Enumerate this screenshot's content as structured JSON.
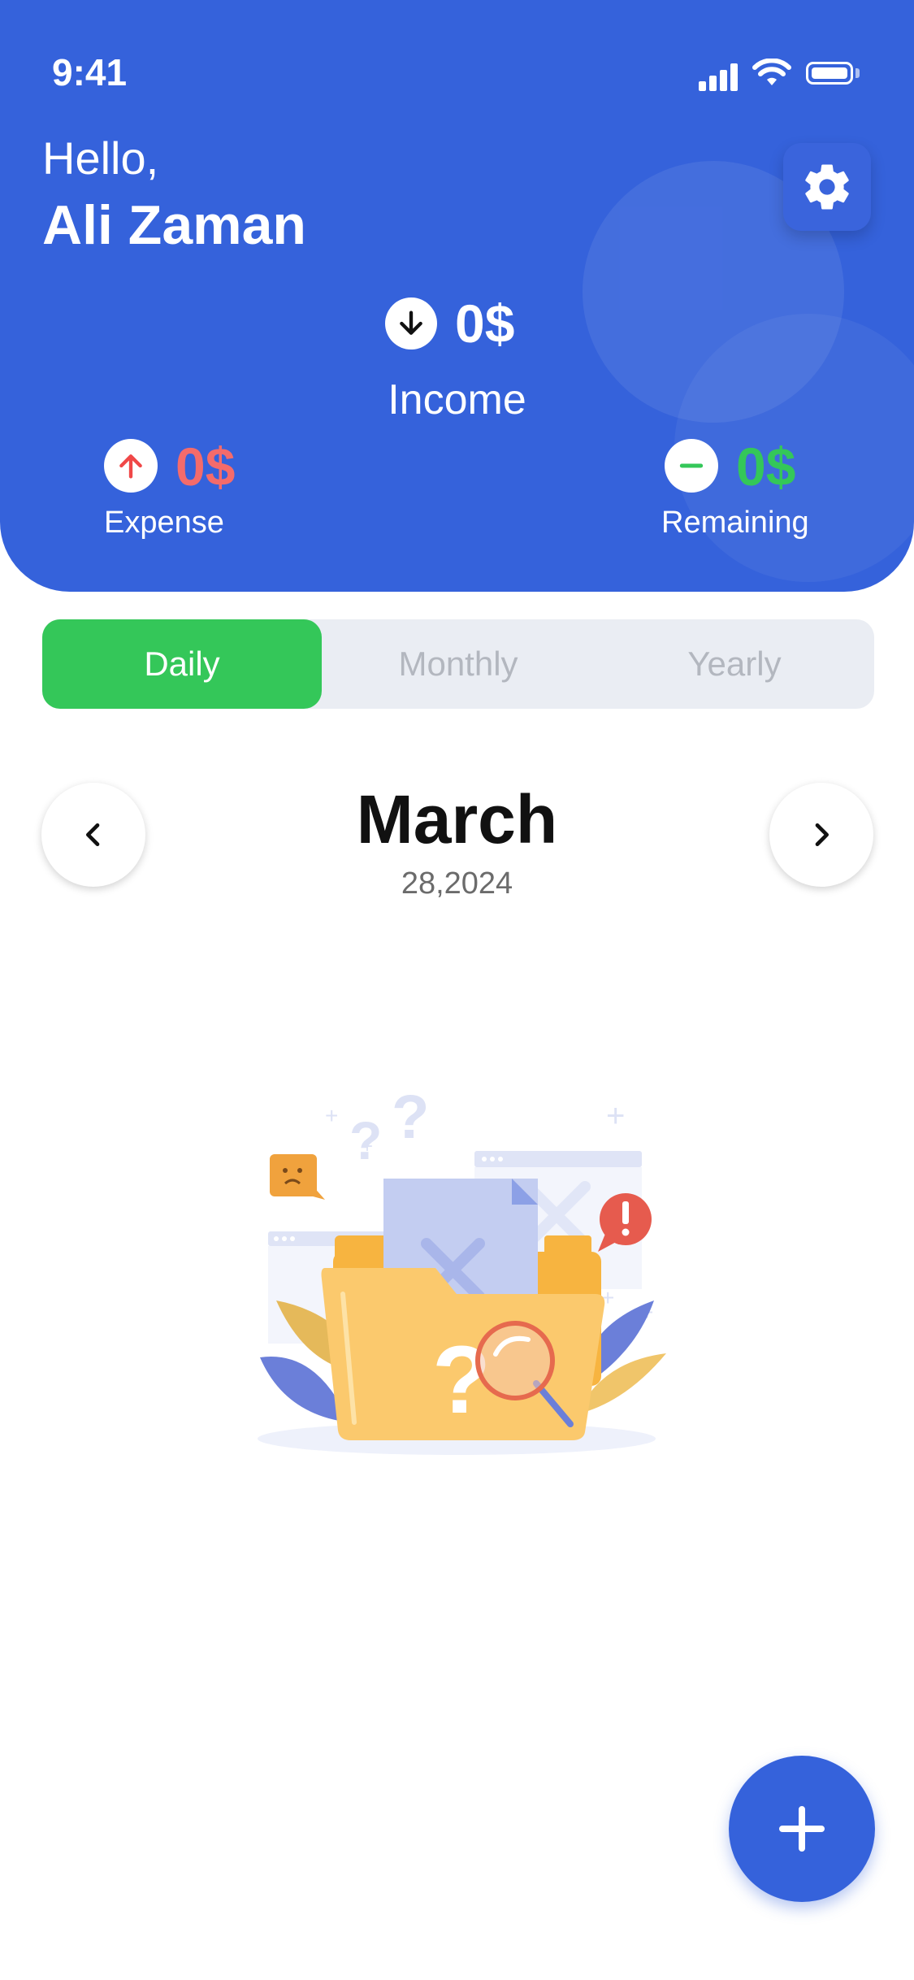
{
  "status_bar": {
    "time": "9:41"
  },
  "header": {
    "greeting": "Hello,",
    "user_name": "Ali Zaman",
    "income": {
      "value": "0$",
      "label": "Income"
    },
    "expense": {
      "value": "0$",
      "label": "Expense"
    },
    "remaining": {
      "value": "0$",
      "label": "Remaining"
    }
  },
  "tabs": [
    {
      "label": "Daily",
      "active": true
    },
    {
      "label": "Monthly",
      "active": false
    },
    {
      "label": "Yearly",
      "active": false
    }
  ],
  "date_nav": {
    "month": "March",
    "date": "28,2024"
  },
  "colors": {
    "primary": "#3562db",
    "income_accent": "#ffffff",
    "expense_accent": "#f46b6b",
    "remaining_accent": "#34c759",
    "tab_active": "#34c759"
  },
  "icons": {
    "settings": "gear-icon",
    "income": "arrow-down-icon",
    "expense": "arrow-up-icon",
    "remaining": "minus-icon",
    "prev": "chevron-left-icon",
    "next": "chevron-right-icon",
    "add": "plus-icon"
  }
}
